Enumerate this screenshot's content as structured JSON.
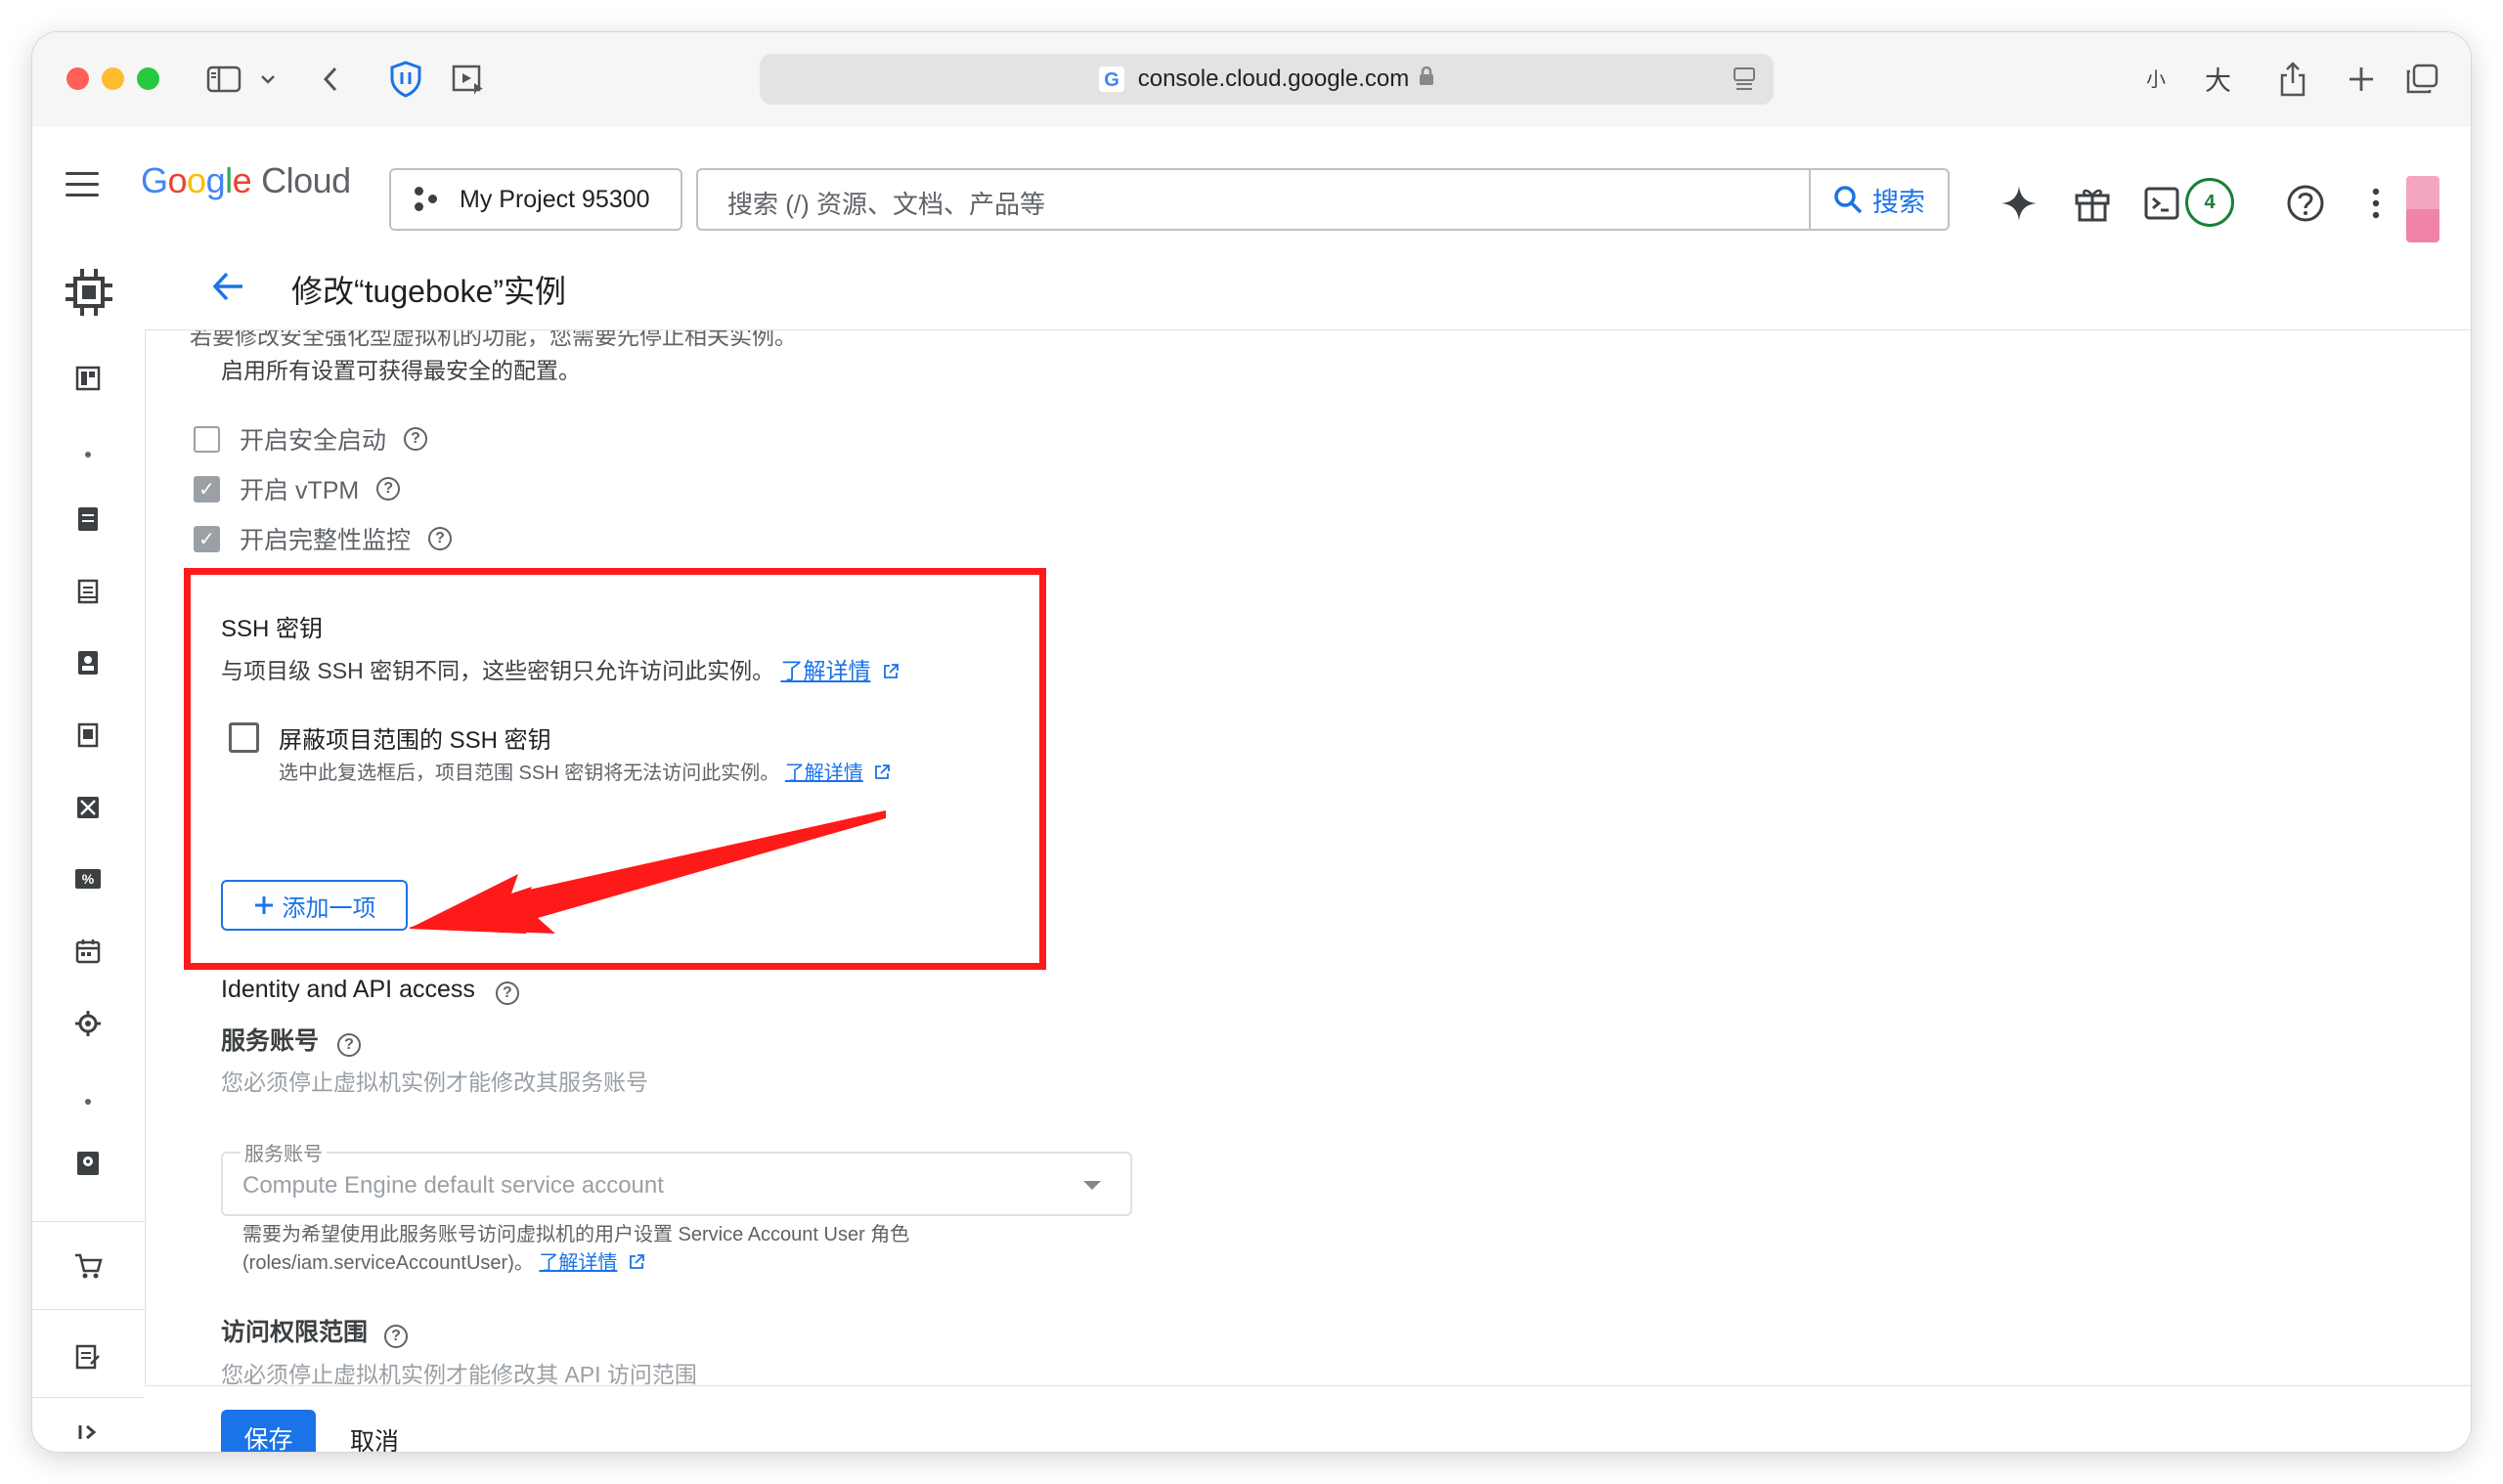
{
  "browser": {
    "url": "console.cloud.google.com",
    "text_size_small": "小",
    "text_size_large": "大"
  },
  "header": {
    "logo_google": [
      "G",
      "o",
      "o",
      "g",
      "l",
      "e"
    ],
    "logo_cloud": "Cloud",
    "project_name": "My Project 95300",
    "search_placeholder": "搜索 (/) 资源、文档、产品等",
    "search_button": "搜索",
    "notification_count": "4"
  },
  "page": {
    "title": "修改“tugeboke”实例"
  },
  "shielded_vm": {
    "cut_text": "若要修改安全强化型虚拟机的功能，您需要先停止相关实例。",
    "note": "启用所有设置可获得最安全的配置。",
    "options": [
      {
        "label": "开启安全启动",
        "checked": false
      },
      {
        "label": "开启 vTPM",
        "checked": true
      },
      {
        "label": "开启完整性监控",
        "checked": true
      }
    ]
  },
  "ssh": {
    "title": "SSH 密钥",
    "description": "与项目级 SSH 密钥不同，这些密钥只允许访问此实例。",
    "learn_more": "了解详情",
    "block_label": "屏蔽项目范围的 SSH 密钥",
    "block_help": "选中此复选框后，项目范围 SSH 密钥将无法访问此实例。",
    "block_learn_more": "了解详情",
    "add_item": "添加一项"
  },
  "identity": {
    "title": "Identity and API access",
    "service_account_title": "服务账号",
    "service_account_note": "您必须停止虚拟机实例才能修改其服务账号",
    "select_label": "服务账号",
    "select_value": "Compute Engine default service account",
    "helper_line1": "需要为希望使用此服务账号访问虚拟机的用户设置 Service Account User 角色",
    "helper_line2": "(roles/iam.serviceAccountUser)。",
    "helper_learn_more": "了解详情",
    "scopes_title": "访问权限范围",
    "scopes_note": "您必须停止虚拟机实例才能修改其 API 访问范围"
  },
  "footer": {
    "save": "保存",
    "cancel": "取消"
  },
  "colors": {
    "primary": "#1a73e8",
    "highlight": "#ff1a1a",
    "badge": "#188038"
  }
}
